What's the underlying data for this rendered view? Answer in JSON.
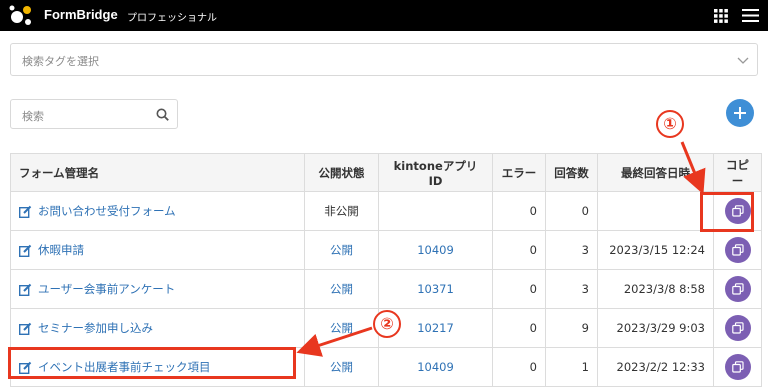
{
  "app": {
    "brand": "FormBridge",
    "plan": "プロフェッショナル"
  },
  "tag_select": {
    "placeholder": "検索タグを選択"
  },
  "search": {
    "placeholder": "検索"
  },
  "table": {
    "headers": [
      "フォーム管理名",
      "公開状態",
      "kintoneアプリID",
      "エラー",
      "回答数",
      "最終回答日時",
      "コピー"
    ],
    "rows": [
      {
        "name": "お問い合わせ受付フォーム",
        "status": "非公開",
        "app_id": "",
        "errors": "0",
        "answers": "0",
        "last": ""
      },
      {
        "name": "休暇申請",
        "status": "公開",
        "app_id": "10409",
        "errors": "0",
        "answers": "3",
        "last": "2023/3/15 12:24"
      },
      {
        "name": "ユーザー会事前アンケート",
        "status": "公開",
        "app_id": "10371",
        "errors": "0",
        "answers": "3",
        "last": "2023/3/8 8:58"
      },
      {
        "name": "セミナー参加申し込み",
        "status": "公開",
        "app_id": "10217",
        "errors": "0",
        "answers": "9",
        "last": "2023/3/29 9:03"
      },
      {
        "name": "イベント出展者事前チェック項目",
        "status": "公開",
        "app_id": "10409",
        "errors": "0",
        "answers": "1",
        "last": "2023/2/2 12:33"
      }
    ]
  },
  "annotations": {
    "one": "①",
    "two": "②",
    "color": "#e8371f"
  }
}
